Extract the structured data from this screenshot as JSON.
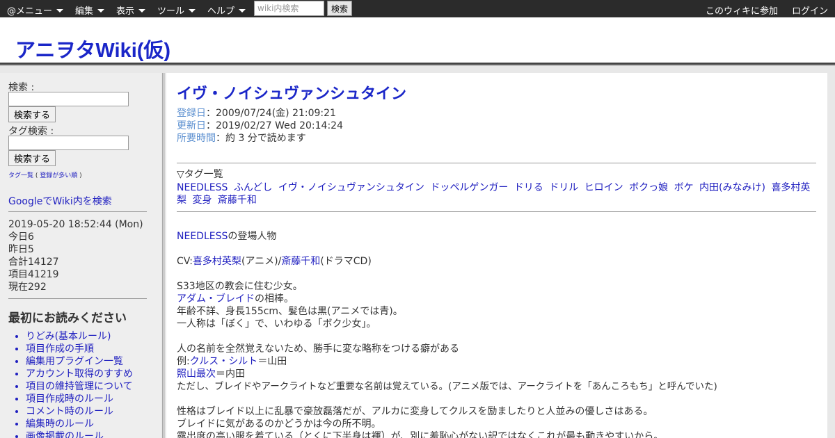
{
  "topbar": {
    "menus": [
      "@メニュー",
      "編集",
      "表示",
      "ツール",
      "ヘルプ"
    ],
    "search_placeholder": "wiki内検索",
    "search_button": "検索",
    "join": "このウィキに参加",
    "login": "ログイン"
  },
  "header": {
    "title": "アニヲタWiki(仮)"
  },
  "sidebar": {
    "search_label": "検索 :",
    "search_button": "検索する",
    "tag_search_label": "タグ検索 :",
    "tag_search_button": "検索する",
    "tag_list": "タグ一覧",
    "tag_popular": "登録が多い順",
    "google_search": "GoogleでWiki内を検索",
    "datetime": "2019-05-20 18:52:44 (Mon)",
    "stats": [
      "今日6",
      "昨日5",
      "合計14127",
      "項目41219",
      "現在292"
    ],
    "section_title": "最初にお読みください",
    "links": [
      "りどみ(基本ルール)",
      "項目作成の手順",
      "編集用プラグイン一覧",
      "アカウント取得のすすめ",
      "項目の維持管理について",
      "項目作成時のルール",
      "コメント時のルール",
      "編集時のルール",
      "画像掲載のルール"
    ]
  },
  "article": {
    "title": "イヴ・ノイシュヴァンシュタイン",
    "registered_label": "登録日",
    "registered": "：2009/07/24(金) 21:09:21",
    "updated_label": "更新日",
    "updated": "：2019/02/27 Wed 20:14:24",
    "readtime_label": "所要時間",
    "readtime": "：約 3 分で読めます",
    "tag_header": "▽タグ一覧",
    "tags": [
      "NEEDLESS",
      "ふんどし",
      "イヴ・ノイシュヴァンシュタイン",
      "ドッペルゲンガー",
      "ドリる",
      "ドリル",
      "ヒロイン",
      "ボクっ娘",
      "ボケ",
      "内田(みなみけ)",
      "喜多村英梨",
      "変身",
      "斎藤千和"
    ],
    "body": {
      "needless_link": "NEEDLESS",
      "needless_rest": "の登場人物",
      "cv_prefix": "CV:",
      "cv_anime_va": "喜多村英梨",
      "cv_anime_suffix": "(アニメ)/",
      "cv_drama_va": "斎藤千和",
      "cv_drama_suffix": "(ドラマCD)",
      "l1": "S33地区の教会に住む少女。",
      "adam_link": "アダム・ブレイド",
      "adam_rest": "の相棒。",
      "l3": "年齢不詳、身長155cm、髪色は黒(アニメでは青)。",
      "l4": "一人称は「ぼく」で、いわゆる「ボク少女」。",
      "l5": "人の名前を全然覚えないため、勝手に変な略称をつける癖がある",
      "ex_prefix": "例:",
      "cruz_link": "クルス・シルト",
      "cruz_rest": "＝山田",
      "teruyama_link": "照山最次",
      "teruyama_rest": "＝内田",
      "l8": "ただし、ブレイドやアークライトなど重要な名前は覚えている。(アニメ版では、アークライトを「あんころもち」と呼んでいた)",
      "l9": "性格はブレイド以上に乱暴で豪放磊落だが、アルカに変身してクルスを励ましたりと人並みの優しさはある。",
      "l10": "ブレイドに気があるのかどうかは今の所不明。",
      "l11": "露出度の高い服を着ている（とくに下半身は褌）が、別に羞恥心がない訳ではなくこれが最も動きやすいから。"
    }
  }
}
